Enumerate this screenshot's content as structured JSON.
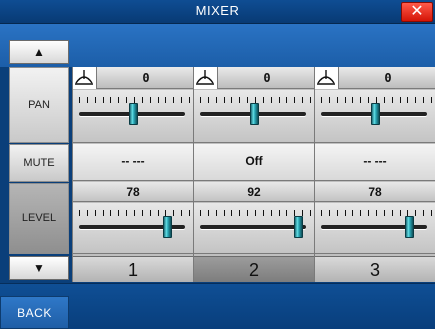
{
  "window": {
    "title": "MIXER",
    "close_symbol": "✕"
  },
  "left": {
    "up": "▲",
    "down": "▼",
    "rows": {
      "pan": "PAN",
      "mute": "MUTE",
      "level": "LEVEL"
    }
  },
  "channels": [
    {
      "number": "1",
      "pan": {
        "value": "0",
        "fraction": 0.5
      },
      "mute": "-- ---",
      "level": {
        "value": "78",
        "fraction": 0.82
      }
    },
    {
      "number": "2",
      "pan": {
        "value": "0",
        "fraction": 0.5
      },
      "mute": "Off",
      "level": {
        "value": "92",
        "fraction": 0.92
      }
    },
    {
      "number": "3",
      "pan": {
        "value": "0",
        "fraction": 0.5
      },
      "mute": "-- ---",
      "level": {
        "value": "78",
        "fraction": 0.82
      }
    }
  ],
  "selected_channel": 2,
  "footer": {
    "back": "BACK"
  }
}
